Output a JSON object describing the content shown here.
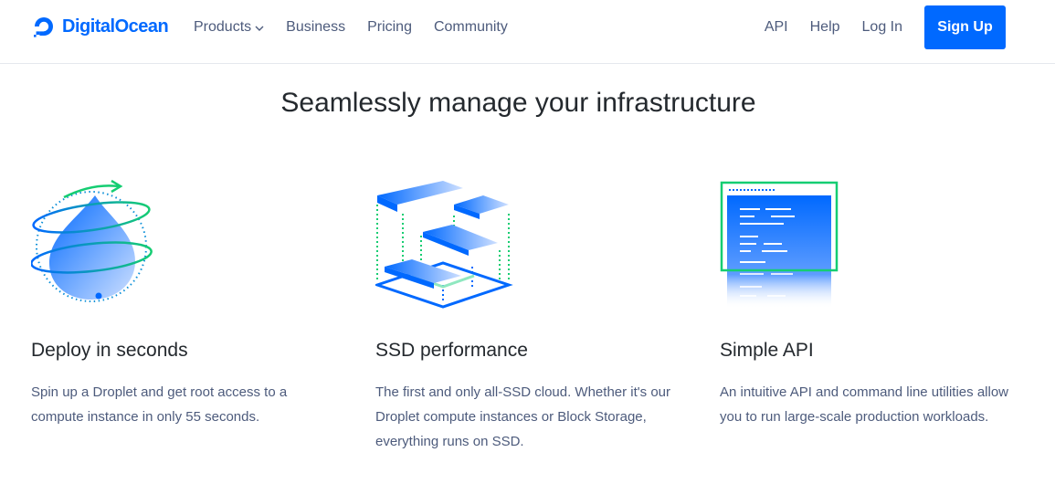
{
  "header": {
    "brand": "DigitalOcean",
    "nav_left": [
      {
        "label": "Products",
        "has_dropdown": true,
        "icon": "chevron-down-icon"
      },
      {
        "label": "Business"
      },
      {
        "label": "Pricing"
      },
      {
        "label": "Community"
      }
    ],
    "nav_right": [
      {
        "label": "API"
      },
      {
        "label": "Help"
      },
      {
        "label": "Log In"
      }
    ],
    "signup_label": "Sign Up"
  },
  "hero": {
    "title": "Seamlessly manage your infrastructure"
  },
  "features": [
    {
      "icon": "droplet-orbit-illustration",
      "title": "Deploy in seconds",
      "description": "Spin up a Droplet and get root access to a compute instance in only 55 seconds."
    },
    {
      "icon": "ssd-blocks-illustration",
      "title": "SSD performance",
      "description": "The first and only all-SSD cloud. Whether it's our Droplet compute instances or Block Storage, everything runs on SSD."
    },
    {
      "icon": "api-terminal-illustration",
      "title": "Simple API",
      "description": "An intuitive API and command line utilities allow you to run large-scale production workloads."
    }
  ],
  "colors": {
    "brand_blue": "#0069ff",
    "accent_green": "#15cd72",
    "text_dark": "#24292e",
    "text_muted": "#4d5b7c"
  }
}
